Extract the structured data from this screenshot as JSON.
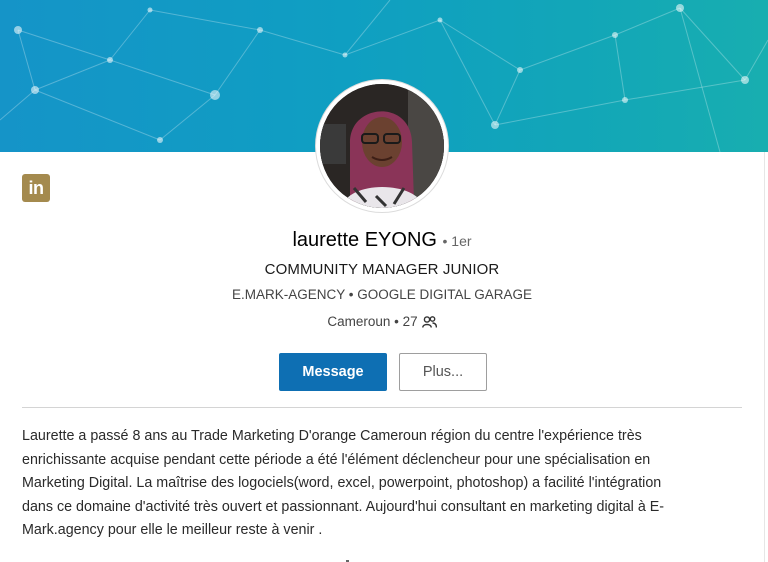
{
  "colors": {
    "banner_start": "#1594c8",
    "banner_end": "#18aeb0",
    "message_button": "#0e6fb3",
    "linkedin_badge": "#a48a4e"
  },
  "icons": {
    "linkedin": "linkedin-icon",
    "connections": "people-icon"
  },
  "linkedin_badge_text": "in",
  "profile": {
    "name": "laurette EYONG",
    "degree": "• 1er",
    "headline": "COMMUNITY MANAGER JUNIOR",
    "companies": "E.MARK-AGENCY • GOOGLE DIGITAL GARAGE",
    "location": "Cameroun",
    "separator": "•",
    "connections": "27"
  },
  "actions": {
    "message_label": "Message",
    "more_label": "Plus..."
  },
  "about": {
    "lines": [
      "Laurette a passé 8 ans au Trade Marketing D'orange Cameroun région du centre l'expérience très",
      "enrichissante acquise pendant cette période a été l'élément déclencheur pour une spécialisation en",
      "Marketing Digital. La maîtrise des logociels(word, excel, powerpoint, photoshop) a facilité l'intégration",
      "dans ce domaine d'activité très ouvert et passionnant. Aujourd'hui consultant en marketing digital à E-",
      "Mark.agency pour elle le meilleur reste à venir ."
    ]
  }
}
